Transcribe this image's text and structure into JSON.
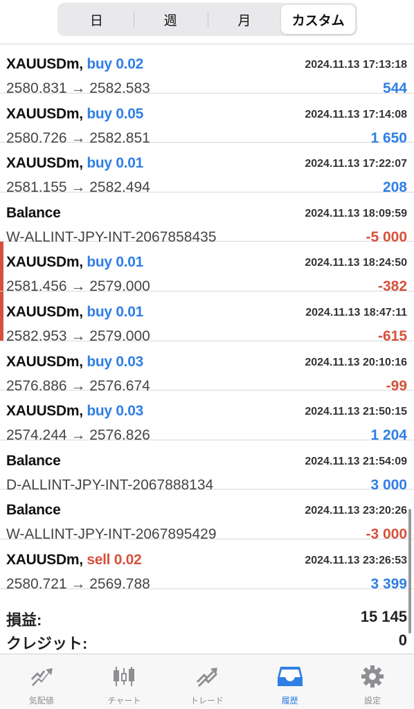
{
  "segments": {
    "items": [
      "日",
      "週",
      "月",
      "カスタム"
    ],
    "active_index": 3
  },
  "deals": [
    {
      "symbol": "XAUUSDm,",
      "direction": "buy",
      "volume_label": "buy 0.02",
      "time": "2024.11.13 17:13:18",
      "prices": "2580.831 → 2582.583",
      "profit": "544",
      "sign": "pos",
      "marked": false
    },
    {
      "symbol": "XAUUSDm,",
      "direction": "buy",
      "volume_label": "buy 0.05",
      "time": "2024.11.13 17:14:08",
      "prices": "2580.726 → 2582.851",
      "profit": "1 650",
      "sign": "pos",
      "marked": false
    },
    {
      "symbol": "XAUUSDm,",
      "direction": "buy",
      "volume_label": "buy 0.01",
      "time": "2024.11.13 17:22:07",
      "prices": "2581.155 → 2582.494",
      "profit": "208",
      "sign": "pos",
      "marked": false
    },
    {
      "symbol": "Balance",
      "direction": "",
      "volume_label": "",
      "time": "2024.11.13 18:09:59",
      "prices": "W-ALLINT-JPY-INT-2067858435",
      "profit": "-5 000",
      "sign": "neg",
      "marked": false
    },
    {
      "symbol": "XAUUSDm,",
      "direction": "buy",
      "volume_label": "buy 0.01",
      "time": "2024.11.13 18:24:50",
      "prices": "2581.456 → 2579.000",
      "profit": "-382",
      "sign": "neg",
      "marked": true
    },
    {
      "symbol": "XAUUSDm,",
      "direction": "buy",
      "volume_label": "buy 0.01",
      "time": "2024.11.13 18:47:11",
      "prices": "2582.953 → 2579.000",
      "profit": "-615",
      "sign": "neg",
      "marked": true
    },
    {
      "symbol": "XAUUSDm,",
      "direction": "buy",
      "volume_label": "buy 0.03",
      "time": "2024.11.13 20:10:16",
      "prices": "2576.886 → 2576.674",
      "profit": "-99",
      "sign": "neg",
      "marked": false
    },
    {
      "symbol": "XAUUSDm,",
      "direction": "buy",
      "volume_label": "buy 0.03",
      "time": "2024.11.13 21:50:15",
      "prices": "2574.244 → 2576.826",
      "profit": "1 204",
      "sign": "pos",
      "marked": false
    },
    {
      "symbol": "Balance",
      "direction": "",
      "volume_label": "",
      "time": "2024.11.13 21:54:09",
      "prices": "D-ALLINT-JPY-INT-2067888134",
      "profit": "3 000",
      "sign": "pos",
      "marked": false
    },
    {
      "symbol": "Balance",
      "direction": "",
      "volume_label": "",
      "time": "2024.11.13 23:20:26",
      "prices": "W-ALLINT-JPY-INT-2067895429",
      "profit": "-3 000",
      "sign": "neg",
      "marked": false
    },
    {
      "symbol": "XAUUSDm,",
      "direction": "sell",
      "volume_label": "sell 0.02",
      "time": "2024.11.13 23:26:53",
      "prices": "2580.721 → 2569.788",
      "profit": "3 399",
      "sign": "pos",
      "marked": false
    }
  ],
  "summary": {
    "profit_label": "損益:",
    "profit_value": "15 145",
    "credit_label": "クレジット:",
    "credit_value": "0"
  },
  "tabbar": {
    "items": [
      {
        "label": "気配値",
        "icon": "quotes-icon"
      },
      {
        "label": "チャート",
        "icon": "chart-icon"
      },
      {
        "label": "トレード",
        "icon": "trade-icon"
      },
      {
        "label": "履歴",
        "icon": "history-icon"
      },
      {
        "label": "設定",
        "icon": "settings-icon"
      }
    ],
    "active_index": 3
  },
  "colors": {
    "accent": "#2f7fe5",
    "negative": "#d6513b"
  }
}
